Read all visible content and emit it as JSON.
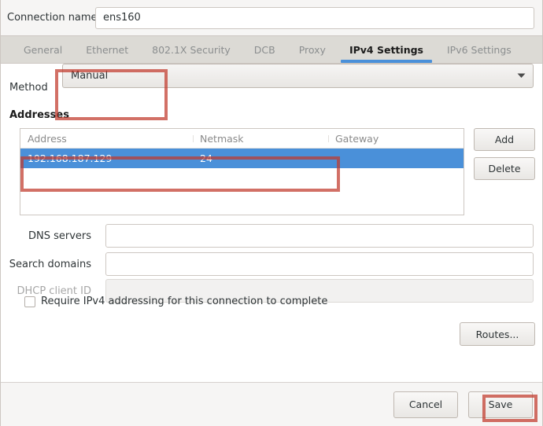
{
  "window": {
    "connection_name_label": "Connection name",
    "connection_name_value": "ens160"
  },
  "tabs": [
    {
      "label": "General",
      "active": false
    },
    {
      "label": "Ethernet",
      "active": false
    },
    {
      "label": "802.1X Security",
      "active": false
    },
    {
      "label": "DCB",
      "active": false
    },
    {
      "label": "Proxy",
      "active": false
    },
    {
      "label": "IPv4 Settings",
      "active": true
    },
    {
      "label": "IPv6 Settings",
      "active": false
    }
  ],
  "ipv4": {
    "method_label": "Method",
    "method_value": "Manual",
    "addresses_label": "Addresses",
    "table": {
      "columns": [
        "Address",
        "Netmask",
        "Gateway"
      ],
      "rows": [
        {
          "address": "192.168.187.129",
          "netmask": "24",
          "gateway": ""
        }
      ]
    },
    "add_label": "Add",
    "delete_label": "Delete",
    "dns_servers_label": "DNS servers",
    "dns_servers_value": "",
    "search_domains_label": "Search domains",
    "search_domains_value": "",
    "dhcp_client_id_label": "DHCP client ID",
    "dhcp_client_id_value": "",
    "require_ipv4_label": "Require IPv4 addressing for this connection to complete",
    "require_ipv4_checked": false,
    "routes_label": "Routes..."
  },
  "footer": {
    "cancel_label": "Cancel",
    "save_label": "Save"
  },
  "icons": {
    "dropdown": "chevron-down-icon"
  },
  "colors": {
    "accent_blue": "#4a90d9",
    "annotation_red": "#c0392b",
    "window_bg": "#f6f5f4",
    "tabbar_bg": "#dcdad5"
  },
  "annotations": [
    {
      "name": "method-highlight",
      "target": "method-combobox"
    },
    {
      "name": "address-row-highlight",
      "target": "address-table-row"
    },
    {
      "name": "save-highlight",
      "target": "save-button"
    }
  ]
}
